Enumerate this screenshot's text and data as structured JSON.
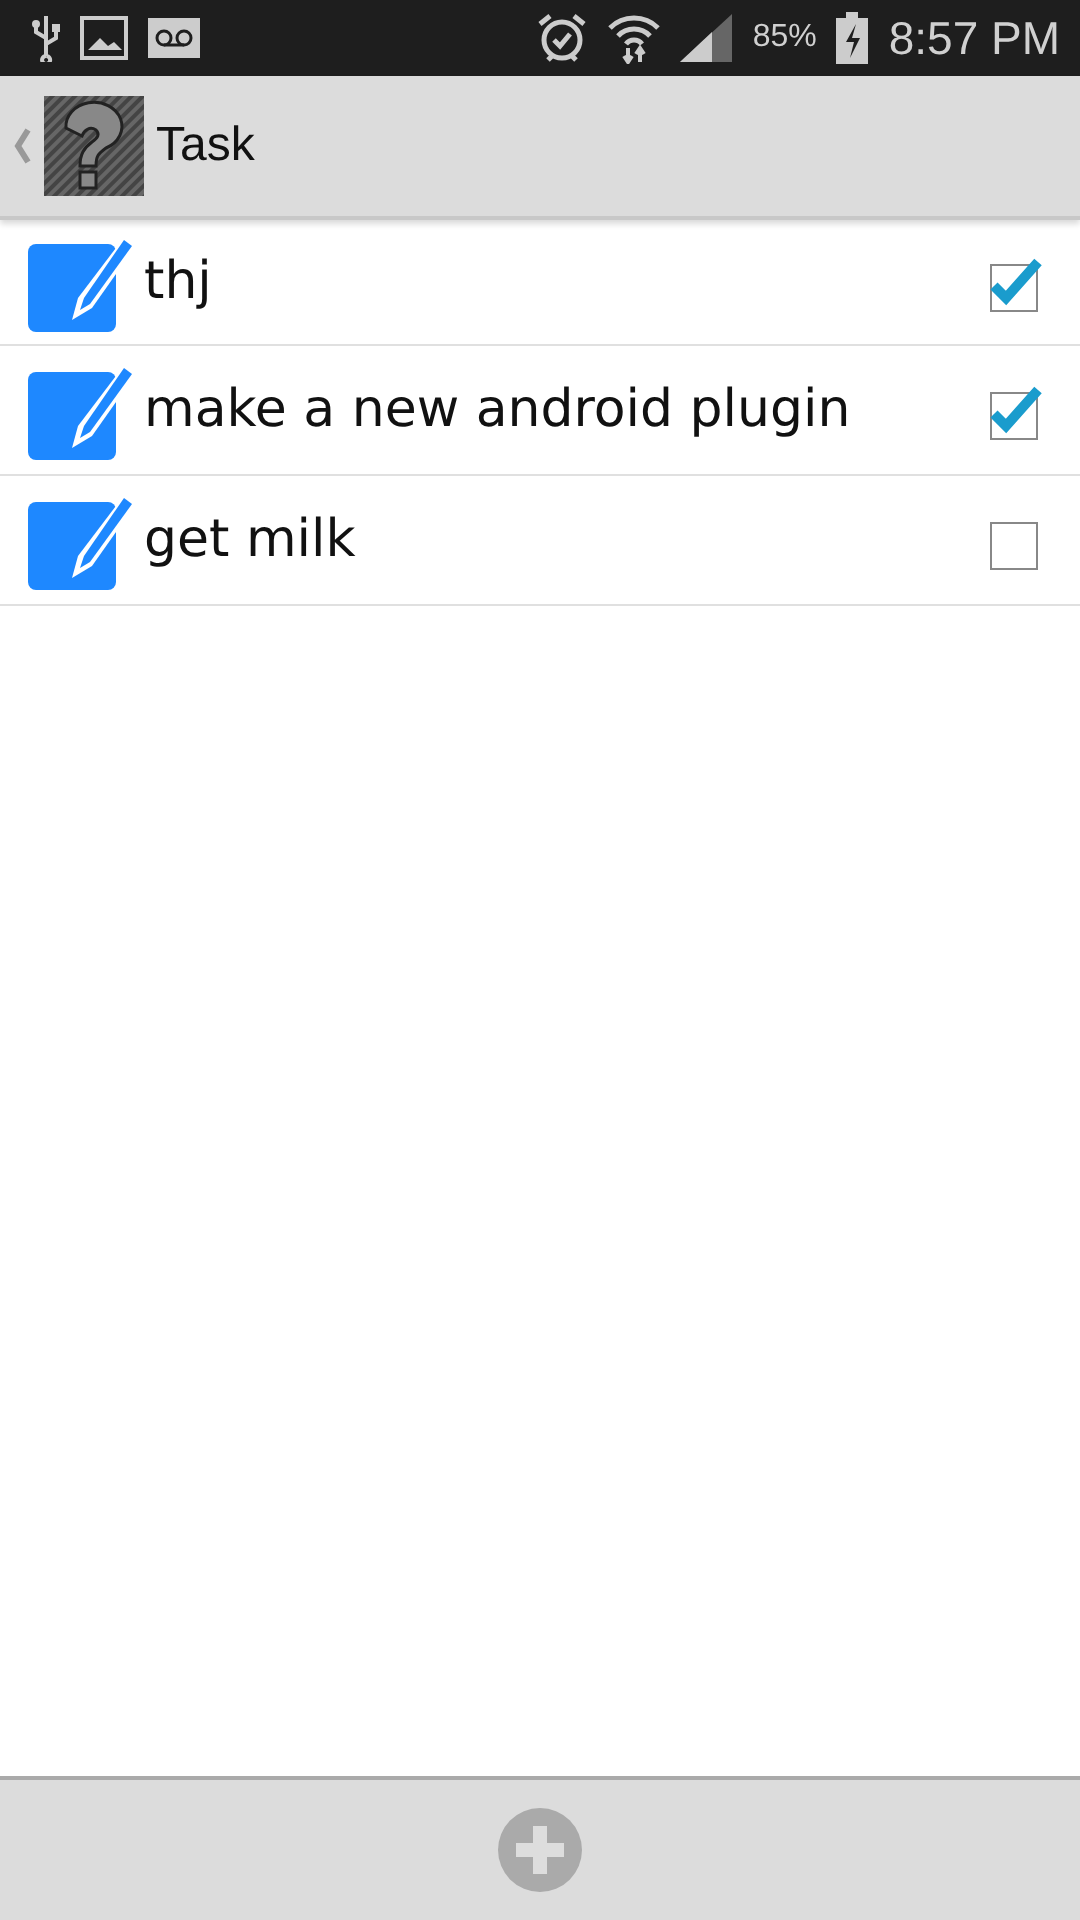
{
  "status_bar": {
    "battery": "85%",
    "time": "8:57 PM"
  },
  "action_bar": {
    "title": "Task"
  },
  "tasks": [
    {
      "title": "thj",
      "checked": true
    },
    {
      "title": "make a new android plugin",
      "checked": true
    },
    {
      "title": "get milk",
      "checked": false
    }
  ]
}
